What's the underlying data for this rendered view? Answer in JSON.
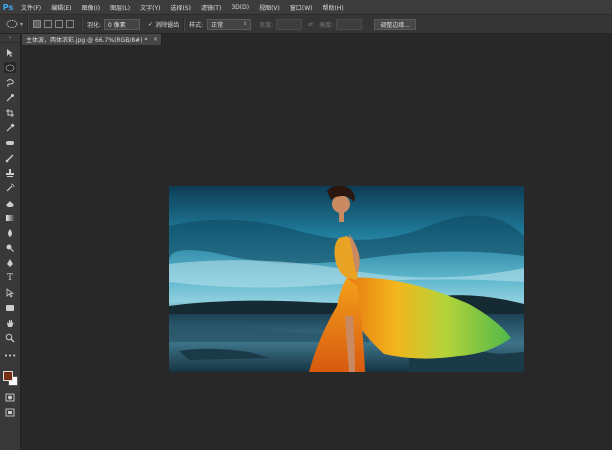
{
  "app": {
    "logo": "Ps"
  },
  "menu": [
    "文件(F)",
    "编辑(E)",
    "图像(I)",
    "图层(L)",
    "文字(Y)",
    "选择(S)",
    "滤镜(T)",
    "3D(D)",
    "视图(V)",
    "窗口(W)",
    "帮助(H)"
  ],
  "options": {
    "feather_label": "羽化:",
    "feather_value": "0 像素",
    "antialias_label": "消除锯齿",
    "style_label": "样式:",
    "style_value": "正常",
    "width_label": "宽度:",
    "height_label": "高度:",
    "refine_edge_button": "调整边缘..."
  },
  "document": {
    "tab_title": "主体波，两体浓彩.jpg @ 66.7%(RGB/8#) *",
    "close": "×"
  },
  "toolbar": {
    "collapse": "»"
  },
  "colors": {
    "foreground": "#7a2d16",
    "background": "#ffffff",
    "accent": "#3fa9f5"
  }
}
